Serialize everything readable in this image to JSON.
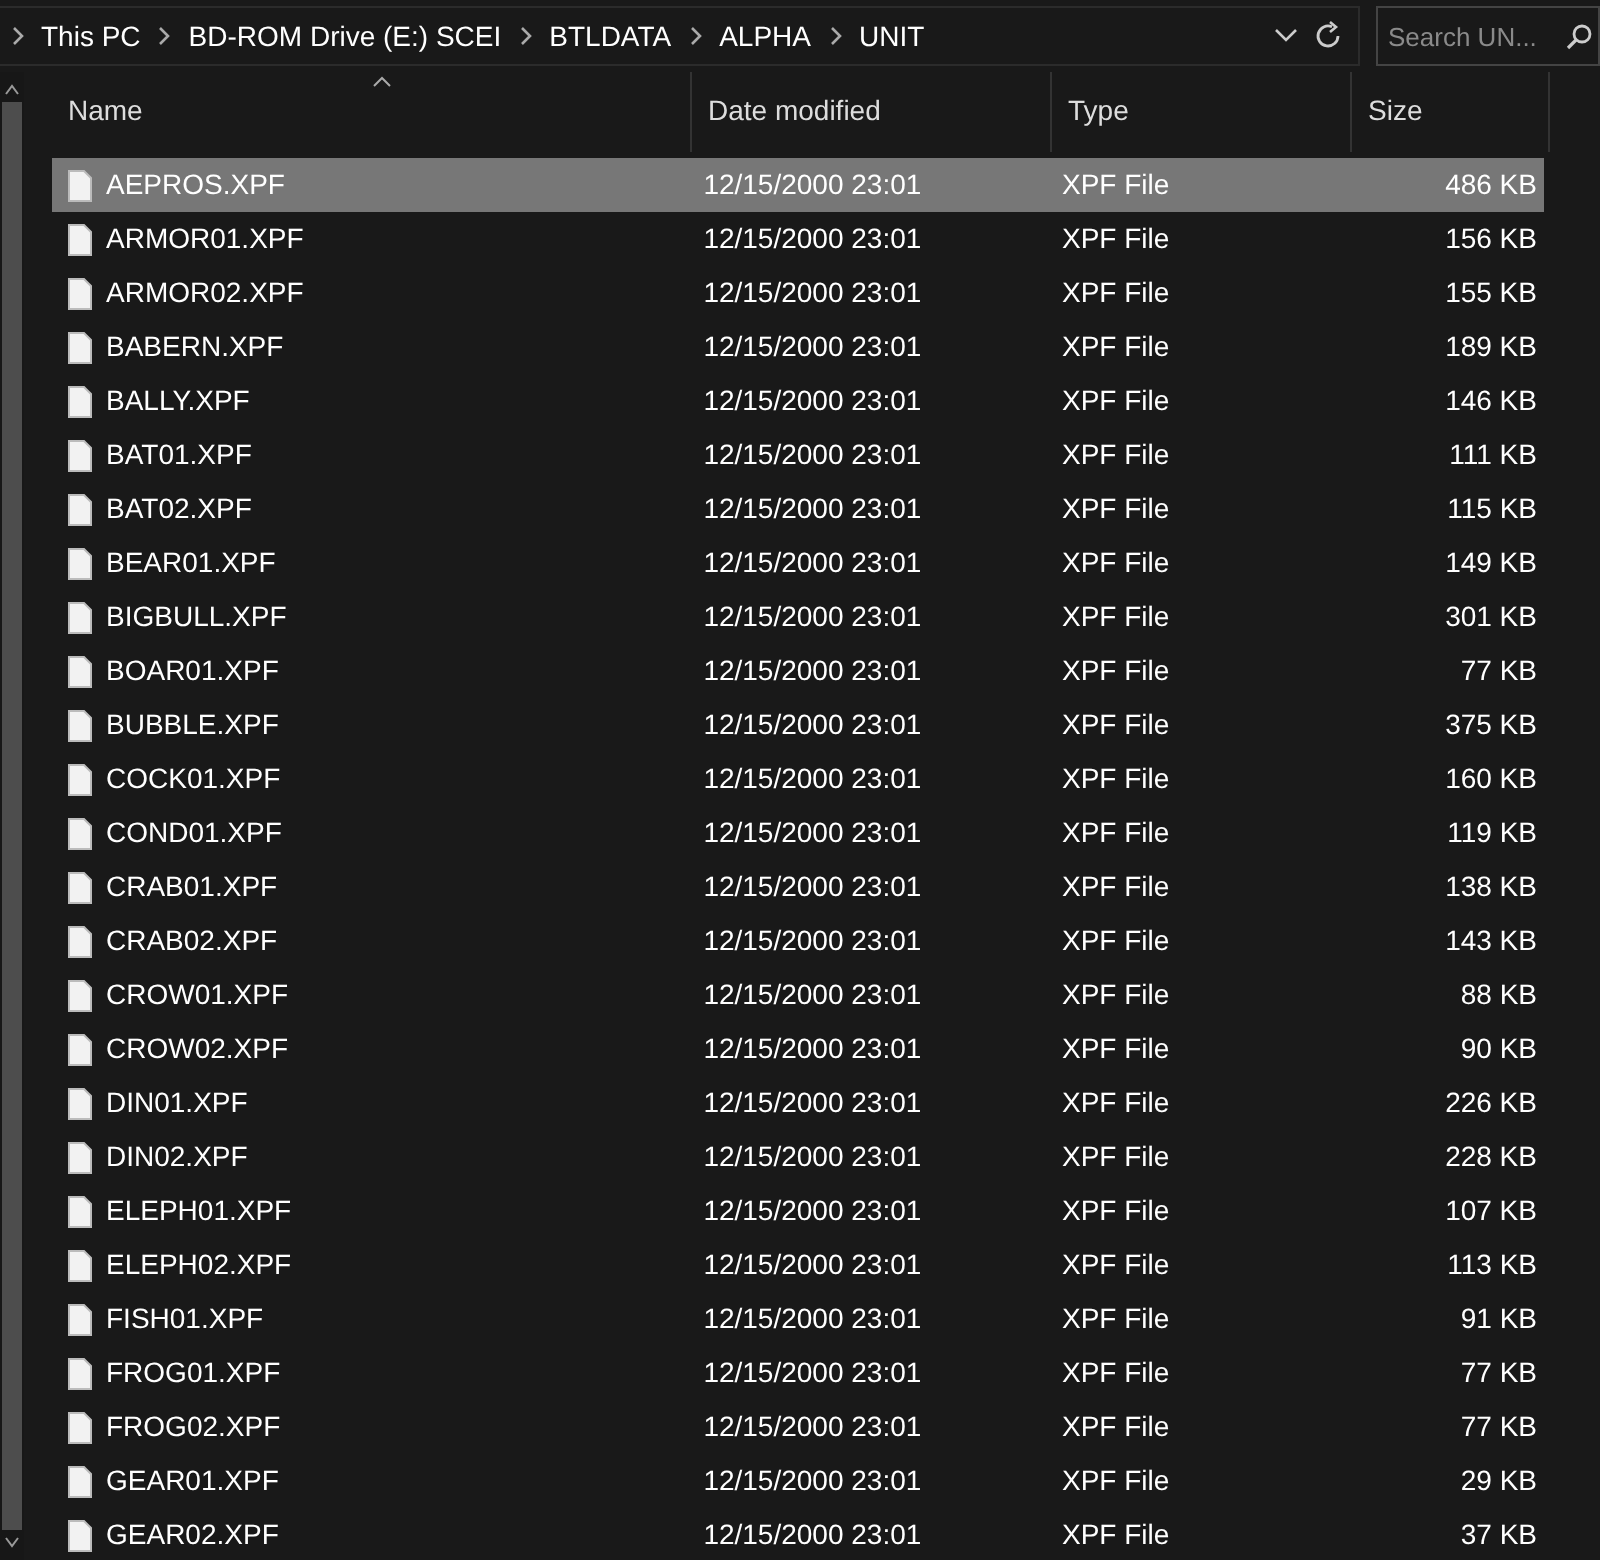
{
  "address_bar": {
    "breadcrumbs": [
      "This PC",
      "BD-ROM Drive (E:) SCEI",
      "BTLDATA",
      "ALPHA",
      "UNIT"
    ]
  },
  "search": {
    "placeholder": "Search UN..."
  },
  "columns": [
    {
      "label": "Name",
      "sorted": true
    },
    {
      "label": "Date modified",
      "sorted": false
    },
    {
      "label": "Type",
      "sorted": false
    },
    {
      "label": "Size",
      "sorted": false
    }
  ],
  "rows": [
    {
      "name": "AEPROS.XPF",
      "date": "12/15/2000 23:01",
      "type": "XPF File",
      "size": "486 KB",
      "selected": true
    },
    {
      "name": "ARMOR01.XPF",
      "date": "12/15/2000 23:01",
      "type": "XPF File",
      "size": "156 KB",
      "selected": false
    },
    {
      "name": "ARMOR02.XPF",
      "date": "12/15/2000 23:01",
      "type": "XPF File",
      "size": "155 KB",
      "selected": false
    },
    {
      "name": "BABERN.XPF",
      "date": "12/15/2000 23:01",
      "type": "XPF File",
      "size": "189 KB",
      "selected": false
    },
    {
      "name": "BALLY.XPF",
      "date": "12/15/2000 23:01",
      "type": "XPF File",
      "size": "146 KB",
      "selected": false
    },
    {
      "name": "BAT01.XPF",
      "date": "12/15/2000 23:01",
      "type": "XPF File",
      "size": "111 KB",
      "selected": false
    },
    {
      "name": "BAT02.XPF",
      "date": "12/15/2000 23:01",
      "type": "XPF File",
      "size": "115 KB",
      "selected": false
    },
    {
      "name": "BEAR01.XPF",
      "date": "12/15/2000 23:01",
      "type": "XPF File",
      "size": "149 KB",
      "selected": false
    },
    {
      "name": "BIGBULL.XPF",
      "date": "12/15/2000 23:01",
      "type": "XPF File",
      "size": "301 KB",
      "selected": false
    },
    {
      "name": "BOAR01.XPF",
      "date": "12/15/2000 23:01",
      "type": "XPF File",
      "size": "77 KB",
      "selected": false
    },
    {
      "name": "BUBBLE.XPF",
      "date": "12/15/2000 23:01",
      "type": "XPF File",
      "size": "375 KB",
      "selected": false
    },
    {
      "name": "COCK01.XPF",
      "date": "12/15/2000 23:01",
      "type": "XPF File",
      "size": "160 KB",
      "selected": false
    },
    {
      "name": "COND01.XPF",
      "date": "12/15/2000 23:01",
      "type": "XPF File",
      "size": "119 KB",
      "selected": false
    },
    {
      "name": "CRAB01.XPF",
      "date": "12/15/2000 23:01",
      "type": "XPF File",
      "size": "138 KB",
      "selected": false
    },
    {
      "name": "CRAB02.XPF",
      "date": "12/15/2000 23:01",
      "type": "XPF File",
      "size": "143 KB",
      "selected": false
    },
    {
      "name": "CROW01.XPF",
      "date": "12/15/2000 23:01",
      "type": "XPF File",
      "size": "88 KB",
      "selected": false
    },
    {
      "name": "CROW02.XPF",
      "date": "12/15/2000 23:01",
      "type": "XPF File",
      "size": "90 KB",
      "selected": false
    },
    {
      "name": "DIN01.XPF",
      "date": "12/15/2000 23:01",
      "type": "XPF File",
      "size": "226 KB",
      "selected": false
    },
    {
      "name": "DIN02.XPF",
      "date": "12/15/2000 23:01",
      "type": "XPF File",
      "size": "228 KB",
      "selected": false
    },
    {
      "name": "ELEPH01.XPF",
      "date": "12/15/2000 23:01",
      "type": "XPF File",
      "size": "107 KB",
      "selected": false
    },
    {
      "name": "ELEPH02.XPF",
      "date": "12/15/2000 23:01",
      "type": "XPF File",
      "size": "113 KB",
      "selected": false
    },
    {
      "name": "FISH01.XPF",
      "date": "12/15/2000 23:01",
      "type": "XPF File",
      "size": "91 KB",
      "selected": false
    },
    {
      "name": "FROG01.XPF",
      "date": "12/15/2000 23:01",
      "type": "XPF File",
      "size": "77 KB",
      "selected": false
    },
    {
      "name": "FROG02.XPF",
      "date": "12/15/2000 23:01",
      "type": "XPF File",
      "size": "77 KB",
      "selected": false
    },
    {
      "name": "GEAR01.XPF",
      "date": "12/15/2000 23:01",
      "type": "XPF File",
      "size": "29 KB",
      "selected": false
    },
    {
      "name": "GEAR02.XPF",
      "date": "12/15/2000 23:01",
      "type": "XPF File",
      "size": "37 KB",
      "selected": false
    }
  ]
}
